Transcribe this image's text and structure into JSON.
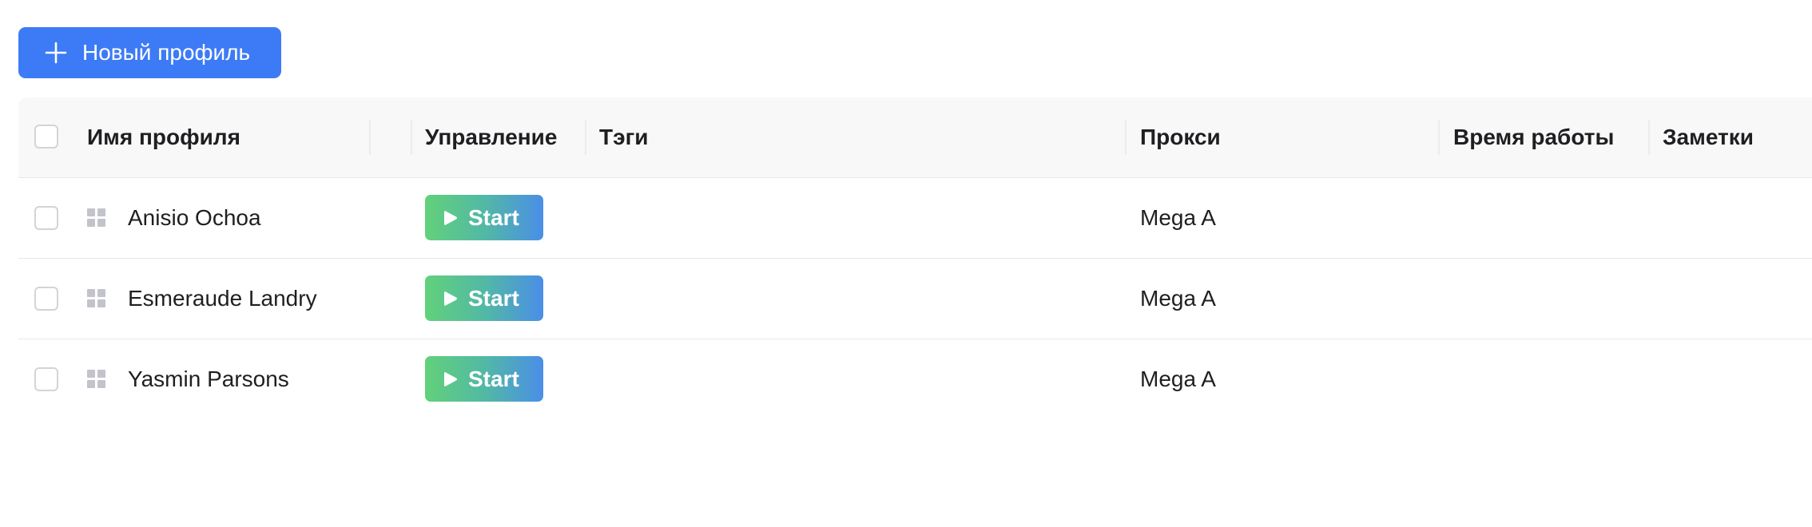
{
  "toolbar": {
    "new_profile_label": "Новый профиль",
    "new_profile_icon": "plus-icon",
    "accent_color": "#3d7bf6"
  },
  "table": {
    "columns": {
      "name": "Имя профиля",
      "control": "Управление",
      "tags": "Тэги",
      "proxy": "Прокси",
      "uptime": "Время работы",
      "notes": "Заметки"
    },
    "rows": [
      {
        "name": "Anisio Ochoa",
        "action": "Start",
        "tags": "",
        "proxy": "Mega A",
        "uptime": "",
        "notes": ""
      },
      {
        "name": "Esmeraude Landry",
        "action": "Start",
        "tags": "",
        "proxy": "Mega A",
        "uptime": "",
        "notes": ""
      },
      {
        "name": "Yasmin Parsons",
        "action": "Start",
        "tags": "",
        "proxy": "Mega A",
        "uptime": "",
        "notes": ""
      }
    ],
    "row_icon": "grid-icon",
    "action_icon": "play-icon"
  }
}
